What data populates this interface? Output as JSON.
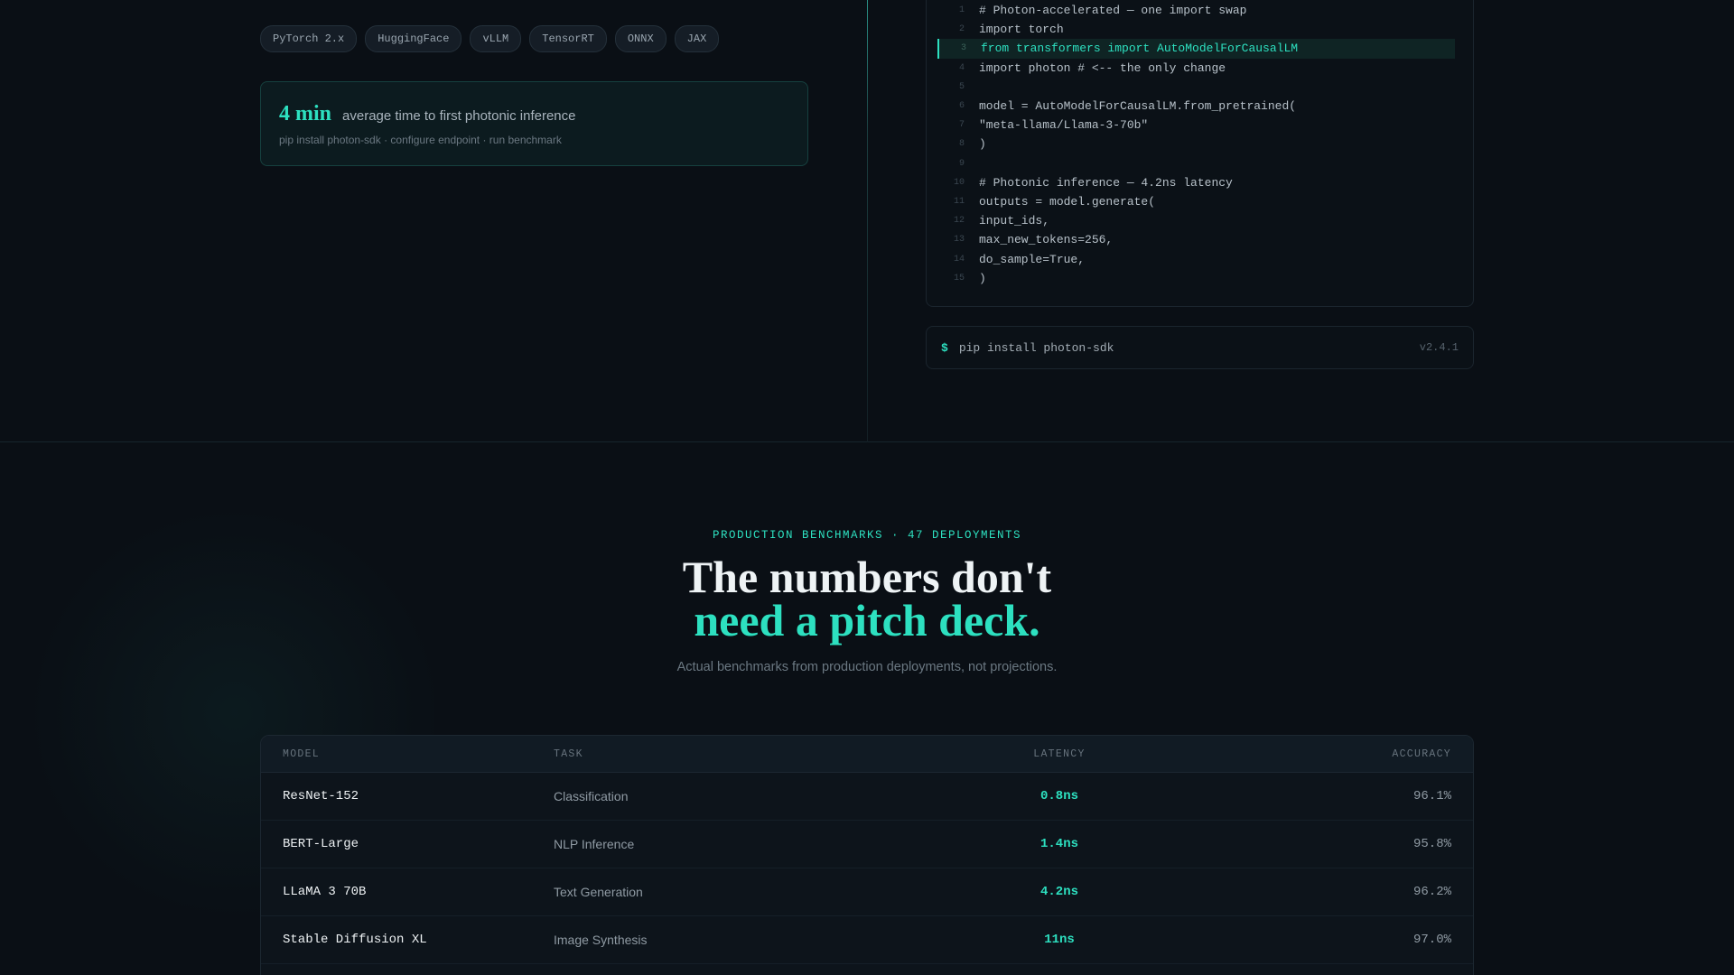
{
  "integration": {
    "tags": [
      "PyTorch 2.x",
      "HuggingFace",
      "vLLM",
      "TensorRT",
      "ONNX",
      "JAX"
    ],
    "stat": {
      "value": "4 min",
      "label": "average time to first photonic inference",
      "steps": "pip install photon-sdk · configure endpoint · run benchmark"
    },
    "code": [
      {
        "n": "1",
        "text": "# Photon-accelerated — one import swap"
      },
      {
        "n": "2",
        "text": "import torch"
      },
      {
        "n": "3",
        "text": "from transformers import AutoModelForCausalLM"
      },
      {
        "n": "4",
        "text": "import photon # <-- the only change"
      },
      {
        "n": "5",
        "text": ""
      },
      {
        "n": "6",
        "text": "model = AutoModelForCausalLM.from_pretrained("
      },
      {
        "n": "7",
        "text": "\"meta-llama/Llama-3-70b\""
      },
      {
        "n": "8",
        "text": ")"
      },
      {
        "n": "9",
        "text": ""
      },
      {
        "n": "10",
        "text": "# Photonic inference — 4.2ns latency"
      },
      {
        "n": "11",
        "text": "outputs = model.generate("
      },
      {
        "n": "12",
        "text": "input_ids,"
      },
      {
        "n": "13",
        "text": "max_new_tokens=256,"
      },
      {
        "n": "14",
        "text": "do_sample=True,"
      },
      {
        "n": "15",
        "text": ")"
      }
    ],
    "highlighted_line": "3",
    "install": {
      "prompt": "$",
      "command": "pip install photon-sdk",
      "version": "v2.4.1"
    }
  },
  "benchmarks": {
    "eyebrow": "PRODUCTION BENCHMARKS · 47 DEPLOYMENTS",
    "headline_line1": "The numbers don't",
    "headline_line2": "need a pitch deck.",
    "subhead": "Actual benchmarks from production deployments, not projections.",
    "table": {
      "columns": [
        "MODEL",
        "TASK",
        "LATENCY",
        "ACCURACY"
      ],
      "rows": [
        {
          "model": "ResNet-152",
          "task": "Classification",
          "latency": "0.8ns",
          "accuracy": "96.1%"
        },
        {
          "model": "BERT-Large",
          "task": "NLP Inference",
          "latency": "1.4ns",
          "accuracy": "95.8%"
        },
        {
          "model": "LLaMA 3 70B",
          "task": "Text Generation",
          "latency": "4.2ns",
          "accuracy": "96.2%"
        },
        {
          "model": "Stable Diffusion XL",
          "task": "Image Synthesis",
          "latency": "11ns",
          "accuracy": "97.0%"
        }
      ]
    }
  },
  "colors": {
    "accent": "#2de0c0",
    "background": "#0a0f15"
  }
}
